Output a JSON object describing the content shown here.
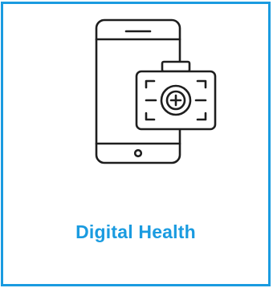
{
  "card": {
    "title": "Digital Health",
    "icon": "phone-medical-kit-icon"
  },
  "colors": {
    "accent": "#1a9be0",
    "icon_stroke": "#1e1e1e",
    "background": "#ffffff"
  }
}
